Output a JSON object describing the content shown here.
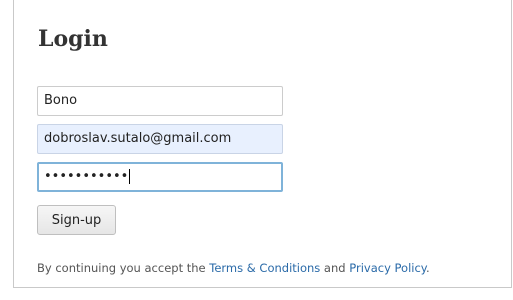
{
  "login": {
    "title": "Login",
    "name_value": "Bono",
    "email_value": "dobroslav.sutalo@gmail.com",
    "password_mask": "•••••••••••",
    "signup_label": "Sign-up"
  },
  "legal": {
    "prefix": "By continuing you accept the ",
    "terms_link": "Terms & Conditions",
    "middle": " and ",
    "privacy_link": "Privacy Policy",
    "suffix": "."
  },
  "colors": {
    "link": "#2a6aa8",
    "autofill_background": "#e8f0fe",
    "focus_border": "#7fb3d9"
  }
}
